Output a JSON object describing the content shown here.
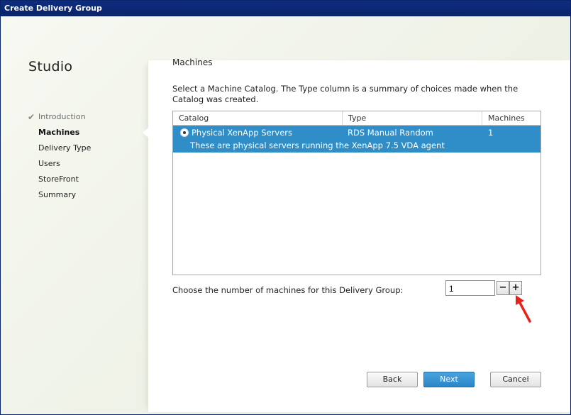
{
  "window": {
    "title": "Create Delivery Group"
  },
  "sidebar": {
    "app_title": "Studio",
    "steps": [
      {
        "label": "Introduction",
        "state": "done"
      },
      {
        "label": "Machines",
        "state": "current"
      },
      {
        "label": "Delivery Type",
        "state": "pending"
      },
      {
        "label": "Users",
        "state": "pending"
      },
      {
        "label": "StoreFront",
        "state": "pending"
      },
      {
        "label": "Summary",
        "state": "pending"
      }
    ]
  },
  "main": {
    "section_title": "Machines",
    "instructions": "Select a Machine Catalog. The Type column is a summary of choices made when the Catalog was created.",
    "table": {
      "columns": [
        "Catalog",
        "Type",
        "Machines"
      ],
      "rows": [
        {
          "catalog": "Physical XenApp Servers",
          "type": "RDS Manual Random",
          "machines": "1",
          "description": "These are physical servers running the XenApp 7.5 VDA agent",
          "selected": true
        }
      ]
    },
    "machine_count": {
      "label": "Choose the number of machines for this Delivery Group:",
      "value": "1",
      "minus": "−",
      "plus": "+"
    }
  },
  "footer": {
    "back": "Back",
    "next": "Next",
    "cancel": "Cancel"
  },
  "colors": {
    "selection": "#2f8ec8",
    "primary_button": "#2a86c8",
    "annotation_arrow": "#e8221b"
  }
}
